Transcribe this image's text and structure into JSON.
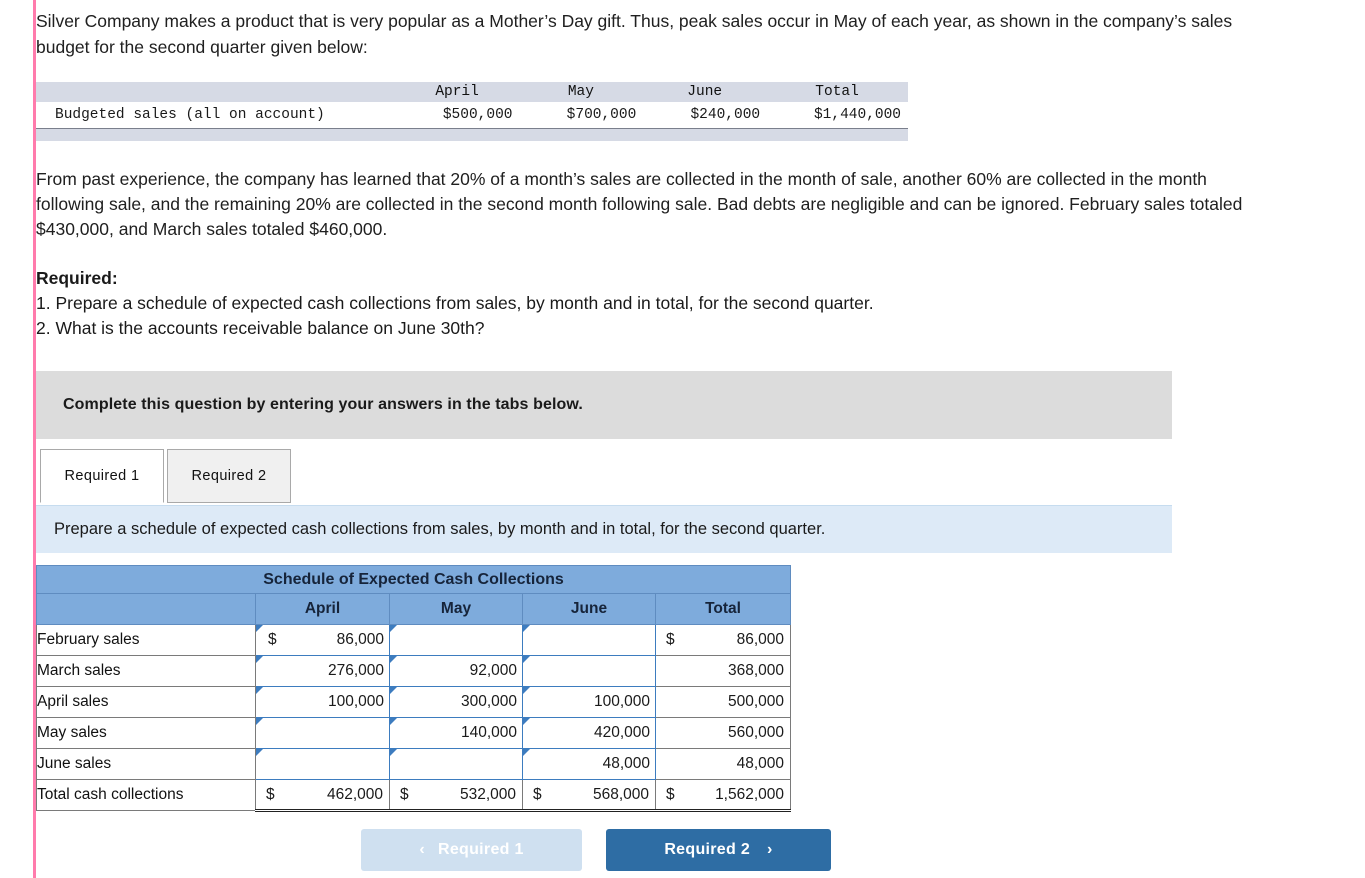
{
  "question": {
    "intro": "Silver Company makes a product that is very popular as a Mother’s Day gift. Thus, peak sales occur in May of each year, as shown in the company’s sales budget for the second quarter given below:",
    "body": "From past experience, the company has learned that 20% of a month’s sales are collected in the month of sale, another 60% are collected in the month following sale, and the remaining 20% are collected in the second month following sale. Bad debts are negligible and can be ignored. February sales totaled $430,000, and March sales totaled $460,000.",
    "required_heading": "Required:",
    "required_1": "1. Prepare a schedule of expected cash collections from sales, by month and in total, for the second quarter.",
    "required_2": "2. What is the accounts receivable balance on June 30th?"
  },
  "budget_table": {
    "columns": [
      "April",
      "May",
      "June",
      "Total"
    ],
    "row_label": "Budgeted sales (all on account)",
    "values": [
      "$500,000",
      "$700,000",
      "$240,000",
      "$1,440,000"
    ]
  },
  "banner": {
    "text": "Complete this question by entering your answers in the tabs below."
  },
  "tabs": [
    {
      "label": "Required 1",
      "active": true
    },
    {
      "label": "Required 2",
      "active": false
    }
  ],
  "prompt": {
    "text": "Prepare a schedule of expected cash collections from sales, by month and in total, for the second quarter."
  },
  "schedule": {
    "title": "Schedule of Expected Cash Collections",
    "blank_header": "",
    "columns": [
      "April",
      "May",
      "June",
      "Total"
    ],
    "rows": [
      {
        "label": "February sales",
        "april": {
          "currency": "$",
          "value": "86,000",
          "input": true
        },
        "may": {
          "currency": "",
          "value": "",
          "input": true
        },
        "june": {
          "currency": "",
          "value": "",
          "input": true
        },
        "total": {
          "currency": "$",
          "value": "86,000",
          "input": false
        }
      },
      {
        "label": "March sales",
        "april": {
          "currency": "",
          "value": "276,000",
          "input": true
        },
        "may": {
          "currency": "",
          "value": "92,000",
          "input": true
        },
        "june": {
          "currency": "",
          "value": "",
          "input": true
        },
        "total": {
          "currency": "",
          "value": "368,000",
          "input": false
        }
      },
      {
        "label": "April sales",
        "april": {
          "currency": "",
          "value": "100,000",
          "input": true
        },
        "may": {
          "currency": "",
          "value": "300,000",
          "input": true
        },
        "june": {
          "currency": "",
          "value": "100,000",
          "input": true
        },
        "total": {
          "currency": "",
          "value": "500,000",
          "input": false
        }
      },
      {
        "label": "May sales",
        "april": {
          "currency": "",
          "value": "",
          "input": true
        },
        "may": {
          "currency": "",
          "value": "140,000",
          "input": true
        },
        "june": {
          "currency": "",
          "value": "420,000",
          "input": true
        },
        "total": {
          "currency": "",
          "value": "560,000",
          "input": false
        }
      },
      {
        "label": "June sales",
        "april": {
          "currency": "",
          "value": "",
          "input": true
        },
        "may": {
          "currency": "",
          "value": "",
          "input": true
        },
        "june": {
          "currency": "",
          "value": "48,000",
          "input": true
        },
        "total": {
          "currency": "",
          "value": "48,000",
          "input": false
        }
      }
    ],
    "total_row": {
      "label": "Total cash collections",
      "april": {
        "currency": "$",
        "value": "462,000"
      },
      "may": {
        "currency": "$",
        "value": "532,000"
      },
      "june": {
        "currency": "$",
        "value": "568,000"
      },
      "total": {
        "currency": "$",
        "value": "1,562,000"
      }
    }
  },
  "footer": {
    "prev_label": "Required 1",
    "prev_chevron": "‹",
    "next_label": "Required 2",
    "next_chevron": "›"
  },
  "colors": {
    "accent_pink": "#ff7bac",
    "table_header_blue": "#7eabdc",
    "input_border_blue": "#3d7cbf",
    "prompt_blue": "#ddeaf7",
    "banner_gray": "#dcdcdc",
    "next_button_blue": "#2e6da4",
    "prev_button_blue": "#cfe0f0"
  }
}
